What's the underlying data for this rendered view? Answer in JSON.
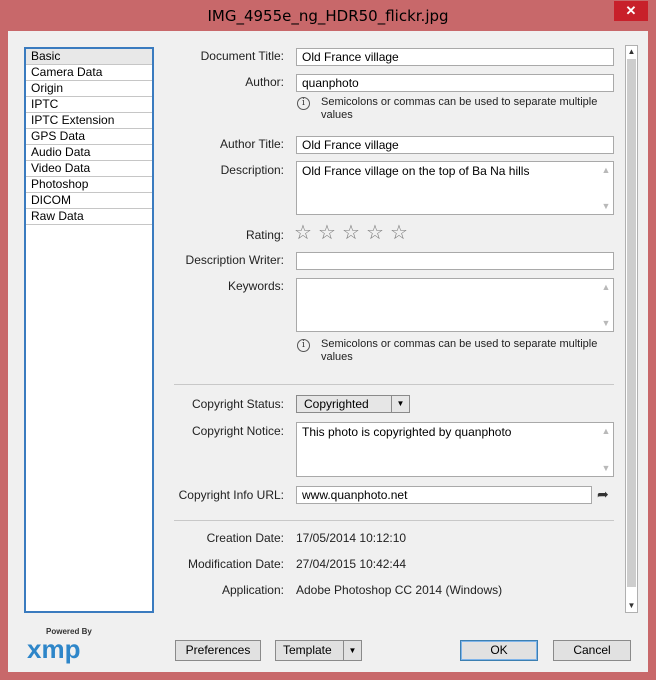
{
  "window": {
    "title": "IMG_4955e_ng_HDR50_flickr.jpg",
    "close_glyph": "✕"
  },
  "categories": [
    {
      "label": "Basic"
    },
    {
      "label": "Camera Data"
    },
    {
      "label": "Origin"
    },
    {
      "label": "IPTC"
    },
    {
      "label": "IPTC Extension"
    },
    {
      "label": "GPS Data"
    },
    {
      "label": "Audio Data"
    },
    {
      "label": "Video Data"
    },
    {
      "label": "Photoshop"
    },
    {
      "label": "DICOM"
    },
    {
      "label": "Raw Data"
    }
  ],
  "fields": {
    "document_title": {
      "label": "Document Title:",
      "value": "Old France village"
    },
    "author": {
      "label": "Author:",
      "value": "quanphoto"
    },
    "author_hint": "Semicolons or commas can be used to separate multiple values",
    "author_title": {
      "label": "Author Title:",
      "value": "Old France village"
    },
    "description": {
      "label": "Description:",
      "value": "Old France village on the top of Ba Na hills"
    },
    "rating": {
      "label": "Rating:",
      "stars": 5,
      "filled": 0
    },
    "description_writer": {
      "label": "Description Writer:",
      "value": ""
    },
    "keywords": {
      "label": "Keywords:",
      "value": ""
    },
    "keywords_hint": "Semicolons or commas can be used to separate multiple values",
    "copyright_status": {
      "label": "Copyright Status:",
      "value": "Copyrighted"
    },
    "copyright_notice": {
      "label": "Copyright Notice:",
      "value": "This photo is copyrighted by quanphoto"
    },
    "copyright_url": {
      "label": "Copyright Info URL:",
      "value": "www.quanphoto.net"
    },
    "creation_date": {
      "label": "Creation Date:",
      "value": "17/05/2014 10:12:10"
    },
    "modification_date": {
      "label": "Modification Date:",
      "value": "27/04/2015 10:42:44"
    },
    "application": {
      "label": "Application:",
      "value": "Adobe Photoshop CC 2014 (Windows)"
    }
  },
  "branding": {
    "powered_by": "Powered By",
    "logo": "xmp"
  },
  "buttons": {
    "preferences": "Preferences",
    "template": "Template",
    "ok": "OK",
    "cancel": "Cancel"
  },
  "colors": {
    "frame": "#c8686a",
    "panel": "#f0f0f0",
    "accent": "#3a7bbf",
    "close": "#c8202a",
    "xmp_blue": "#2e86c9"
  },
  "icons": {
    "info": "info-circle-icon",
    "star": "star-outline-icon",
    "share": "share-arrow-icon",
    "dropdown": "chevron-down-icon"
  }
}
